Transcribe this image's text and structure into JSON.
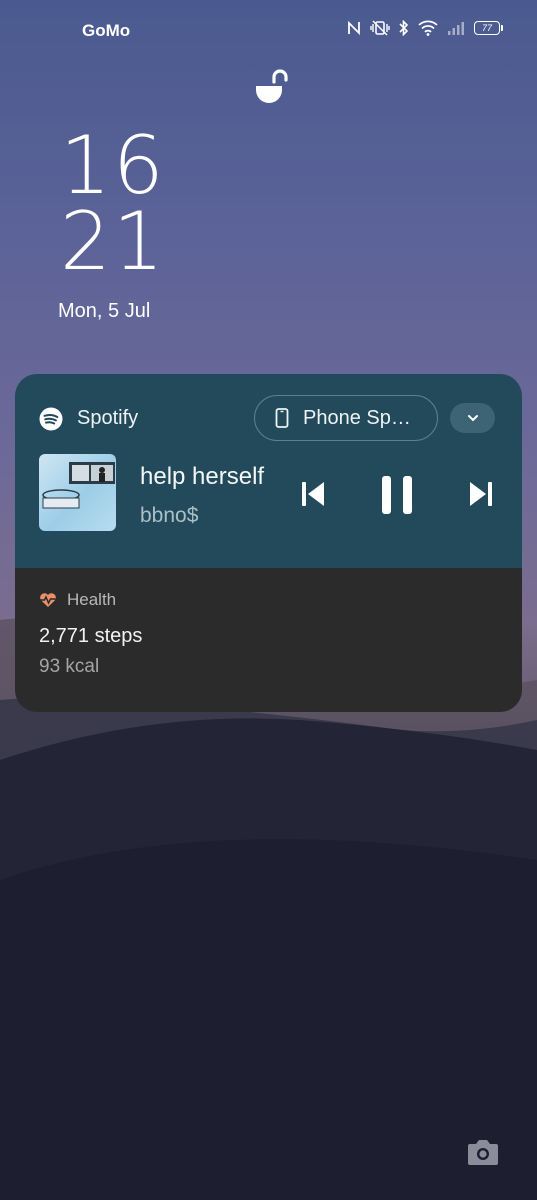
{
  "status_bar": {
    "carrier": "GoMo",
    "battery_level": "77",
    "icons": [
      "nfc-icon",
      "vibrate-icon",
      "bluetooth-icon",
      "wifi-icon",
      "signal-icon",
      "battery-icon"
    ]
  },
  "lock": {
    "icon": "unlock-icon"
  },
  "clock": {
    "hour": "16",
    "minute": "21",
    "date": "Mon, 5 Jul"
  },
  "media": {
    "app_name": "Spotify",
    "output_device": "Phone Sp…",
    "track_title": "help herself",
    "artist": "bbno$",
    "controls": [
      "previous-icon",
      "pause-icon",
      "next-icon"
    ],
    "background_color": "#234a5a"
  },
  "health": {
    "label": "Health",
    "steps": "2,771 steps",
    "calories": "93 kcal",
    "accent_color": "#e8906a"
  },
  "shortcuts": {
    "camera": "camera-icon"
  }
}
